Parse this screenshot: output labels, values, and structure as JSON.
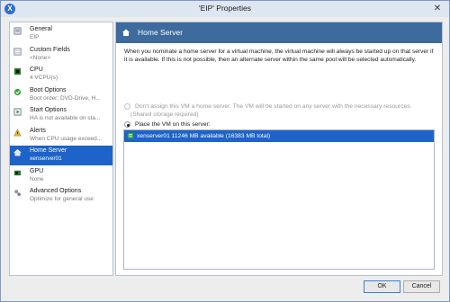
{
  "window": {
    "title": "'EIP' Properties",
    "close_glyph": "✕"
  },
  "sidebar": {
    "items": [
      {
        "title": "General",
        "subtitle": "EIP",
        "icon": "general-icon",
        "selected": false
      },
      {
        "title": "Custom Fields",
        "subtitle": "<None>",
        "icon": "custom-fields-icon",
        "selected": false
      },
      {
        "title": "CPU",
        "subtitle": "4 VCPU(s)",
        "icon": "cpu-icon",
        "selected": false
      },
      {
        "title": "Boot Options",
        "subtitle": "Boot order: DVD-Drive, H...",
        "icon": "boot-options-icon",
        "selected": false
      },
      {
        "title": "Start Options",
        "subtitle": "HA is not available on sta...",
        "icon": "start-options-icon",
        "selected": false
      },
      {
        "title": "Alerts",
        "subtitle": "When CPU usage exceed...",
        "icon": "alerts-icon",
        "selected": false
      },
      {
        "title": "Home Server",
        "subtitle": "xenserver01",
        "icon": "home-server-icon",
        "selected": true
      },
      {
        "title": "GPU",
        "subtitle": "None",
        "icon": "gpu-icon",
        "selected": false
      },
      {
        "title": "Advanced Options",
        "subtitle": "Optimize for general use",
        "icon": "advanced-options-icon",
        "selected": false
      }
    ]
  },
  "panel": {
    "title": "Home Server",
    "description": "When you nominate a home server for a virtual machine, the virtual machine will always be started up on that server if it is available. If this is not possible, then an alternate server within the same pool will be selected automatically.",
    "option_none_label": "Don't assign this VM a home server. The VM will be started on any server with the necessary resources.",
    "option_none_hint": "(Shared storage required)",
    "option_place_label": "Place the VM on this server:",
    "selected_option": "place",
    "servers": [
      {
        "label": "xenserver01  11246 MB available (16383 MB total)",
        "selected": true
      }
    ]
  },
  "buttons": {
    "ok": "OK",
    "cancel": "Cancel"
  },
  "colors": {
    "accent": "#1e63c7",
    "header": "#3d6b9e"
  }
}
